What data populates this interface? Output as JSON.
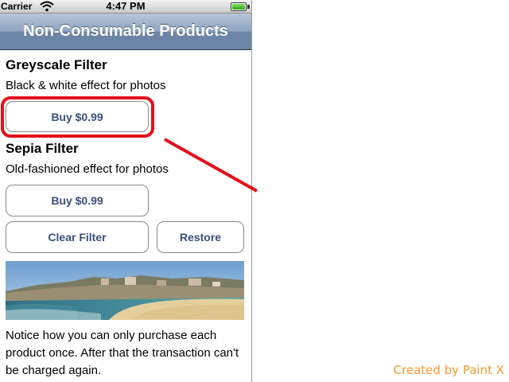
{
  "statusbar": {
    "carrier": "Carrier",
    "time": "4:47 PM",
    "wifi_icon": "wifi-icon",
    "battery_icon": "battery-icon"
  },
  "navbar": {
    "title": "Non-Consumable Products"
  },
  "products": [
    {
      "title": "Greyscale Filter",
      "description": "Black & white effect for photos",
      "buy_label": "Buy $0.99"
    },
    {
      "title": "Sepia Filter",
      "description": "Old-fashioned effect for photos",
      "buy_label": "Buy $0.99"
    }
  ],
  "actions": {
    "clear_label": "Clear Filter",
    "restore_label": "Restore"
  },
  "note": {
    "text": "Notice how you can only purchase each product once. After that the transaction can't be charged again."
  },
  "annotation": {
    "color": "#e3101a"
  },
  "watermark": {
    "text": "Created by Paint X",
    "color": "#f39a2e"
  },
  "colors": {
    "button_text": "#3a4f7a",
    "navbar": "#6d85a7"
  }
}
